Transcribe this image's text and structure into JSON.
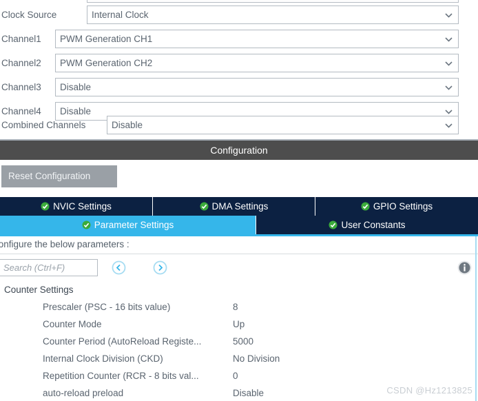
{
  "top_panel": {
    "rows": [
      {
        "label": "Clock Source",
        "value": "Internal Clock",
        "icon": "chevron-down-icon"
      },
      {
        "label": "Channel1",
        "value": "PWM Generation CH1",
        "icon": "chevron-down-icon"
      },
      {
        "label": "Channel2",
        "value": "PWM Generation CH2",
        "icon": "chevron-down-icon"
      },
      {
        "label": "Channel3",
        "value": "Disable",
        "icon": "chevron-down-icon"
      },
      {
        "label": "Channel4",
        "value": "Disable",
        "icon": "chevron-down-icon"
      },
      {
        "label": "Combined Channels",
        "value": "Disable",
        "icon": "chevron-down-icon"
      }
    ]
  },
  "config_bar": {
    "title": "Configuration"
  },
  "reset": {
    "label": "Reset Configuration"
  },
  "tabs": {
    "row1": [
      {
        "label": "NVIC Settings",
        "icon": "green-check-icon",
        "active": false
      },
      {
        "label": "DMA Settings",
        "icon": "green-check-icon",
        "active": false
      },
      {
        "label": "GPIO Settings",
        "icon": "green-check-icon",
        "active": false
      }
    ],
    "row2": [
      {
        "label": "Parameter Settings",
        "icon": "green-check-icon",
        "active": true
      },
      {
        "label": "User Constants",
        "icon": "green-check-icon",
        "active": false
      }
    ]
  },
  "param_pane": {
    "hint": "Configure the below parameters :",
    "search": {
      "placeholder": "Search (Ctrl+F)",
      "value": ""
    },
    "nav_prev_icon": "circle-left-arrow-icon",
    "nav_next_icon": "circle-right-arrow-icon",
    "info_icon": "info-icon",
    "groups": [
      {
        "title": "Counter Settings",
        "rows": [
          {
            "name": "Prescaler (PSC - 16 bits value)",
            "value": "8"
          },
          {
            "name": "Counter Mode",
            "value": "Up"
          },
          {
            "name": "Counter Period (AutoReload Registe...",
            "value": "5000"
          },
          {
            "name": "Internal Clock Division (CKD)",
            "value": "No Division"
          },
          {
            "name": "Repetition Counter (RCR - 8 bits val...",
            "value": "0"
          },
          {
            "name": "auto-reload preload",
            "value": "Disable"
          }
        ]
      }
    ]
  },
  "watermark": {
    "text": "CSDN @Hz1213825"
  },
  "colors": {
    "tab_inactive": "#0c2142",
    "tab_active": "#35b6ea",
    "config_bar": "#4d4d4d",
    "reset_button": "#9aa0a6",
    "check_green": "#3bab3b",
    "text": "#55606b"
  }
}
